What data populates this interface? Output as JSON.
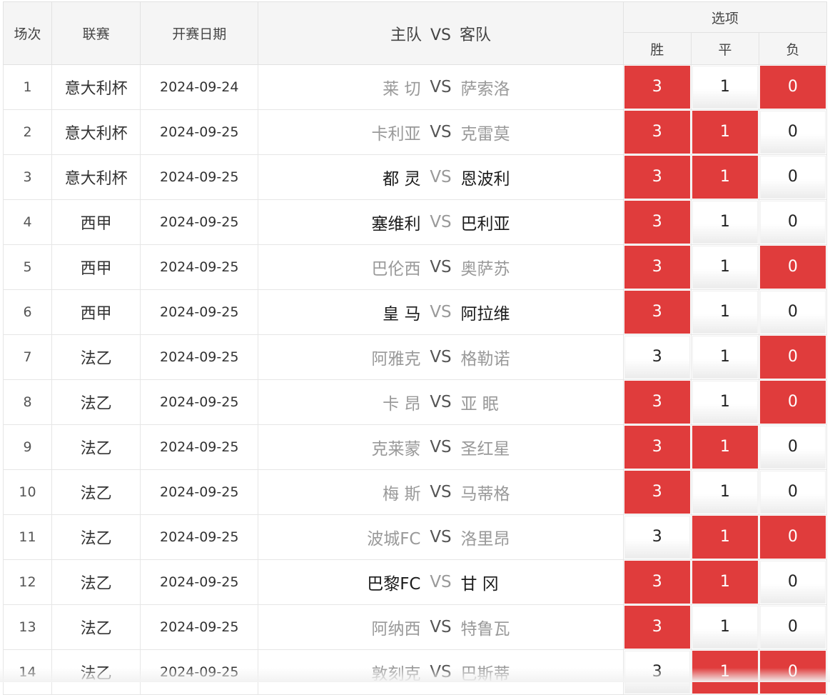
{
  "header": {
    "idx": "场次",
    "league": "联赛",
    "date": "开赛日期",
    "home": "主队",
    "vs": "VS",
    "away": "客队",
    "options": "选项",
    "win": "胜",
    "draw": "平",
    "lose": "负"
  },
  "rows": [
    {
      "idx": "1",
      "league": "意大利杯",
      "date": "2024-09-24",
      "home": "莱 切",
      "vs": "VS",
      "away": "萨索洛",
      "win": "3",
      "draw": "1",
      "lose": "0"
    },
    {
      "idx": "2",
      "league": "意大利杯",
      "date": "2024-09-25",
      "home": "卡利亚",
      "vs": "VS",
      "away": "克雷莫",
      "win": "3",
      "draw": "1",
      "lose": "0"
    },
    {
      "idx": "3",
      "league": "意大利杯",
      "date": "2024-09-25",
      "home": "都 灵",
      "vs": "VS",
      "away": "恩波利",
      "win": "3",
      "draw": "1",
      "lose": "0"
    },
    {
      "idx": "4",
      "league": "西甲",
      "date": "2024-09-25",
      "home": "塞维利",
      "vs": "VS",
      "away": "巴利亚",
      "win": "3",
      "draw": "1",
      "lose": "0"
    },
    {
      "idx": "5",
      "league": "西甲",
      "date": "2024-09-25",
      "home": "巴伦西",
      "vs": "VS",
      "away": "奥萨苏",
      "win": "3",
      "draw": "1",
      "lose": "0"
    },
    {
      "idx": "6",
      "league": "西甲",
      "date": "2024-09-25",
      "home": "皇 马",
      "vs": "VS",
      "away": "阿拉维",
      "win": "3",
      "draw": "1",
      "lose": "0"
    },
    {
      "idx": "7",
      "league": "法乙",
      "date": "2024-09-25",
      "home": "阿雅克",
      "vs": "VS",
      "away": "格勒诺",
      "win": "3",
      "draw": "1",
      "lose": "0"
    },
    {
      "idx": "8",
      "league": "法乙",
      "date": "2024-09-25",
      "home": "卡 昂",
      "vs": "VS",
      "away": "亚 眠",
      "win": "3",
      "draw": "1",
      "lose": "0"
    },
    {
      "idx": "9",
      "league": "法乙",
      "date": "2024-09-25",
      "home": "克莱蒙",
      "vs": "VS",
      "away": "圣红星",
      "win": "3",
      "draw": "1",
      "lose": "0"
    },
    {
      "idx": "10",
      "league": "法乙",
      "date": "2024-09-25",
      "home": "梅 斯",
      "vs": "VS",
      "away": "马蒂格",
      "win": "3",
      "draw": "1",
      "lose": "0"
    },
    {
      "idx": "11",
      "league": "法乙",
      "date": "2024-09-25",
      "home": "波城FC",
      "vs": "VS",
      "away": "洛里昂",
      "win": "3",
      "draw": "1",
      "lose": "0"
    },
    {
      "idx": "12",
      "league": "法乙",
      "date": "2024-09-25",
      "home": "巴黎FC",
      "vs": "VS",
      "away": "甘 冈",
      "win": "3",
      "draw": "1",
      "lose": "0"
    },
    {
      "idx": "13",
      "league": "法乙",
      "date": "2024-09-25",
      "home": "阿纳西",
      "vs": "VS",
      "away": "特鲁瓦",
      "win": "3",
      "draw": "1",
      "lose": "0"
    },
    {
      "idx": "14",
      "league": "法乙",
      "date": "2024-09-25",
      "home": "敦刻克",
      "vs": "VS",
      "away": "巴斯蒂",
      "win": "3",
      "draw": "1",
      "lose": "0"
    }
  ],
  "selection": {
    "r1": {
      "win": true,
      "draw": false,
      "lose": true
    },
    "r2": {
      "win": true,
      "draw": true,
      "lose": false
    },
    "r3": {
      "win": true,
      "draw": true,
      "lose": false
    },
    "r4": {
      "win": true,
      "draw": false,
      "lose": false
    },
    "r5": {
      "win": true,
      "draw": false,
      "lose": true
    },
    "r6": {
      "win": true,
      "draw": false,
      "lose": false
    },
    "r7": {
      "win": false,
      "draw": false,
      "lose": true
    },
    "r8": {
      "win": true,
      "draw": false,
      "lose": true
    },
    "r9": {
      "win": true,
      "draw": true,
      "lose": false
    },
    "r10": {
      "win": true,
      "draw": false,
      "lose": false
    },
    "r11": {
      "win": false,
      "draw": true,
      "lose": true
    },
    "r12": {
      "win": true,
      "draw": true,
      "lose": false
    },
    "r13": {
      "win": true,
      "draw": false,
      "lose": false
    },
    "r14": {
      "win": false,
      "draw": true,
      "lose": true
    }
  },
  "team_style": {
    "r1": "dim",
    "r2": "dim",
    "r3": "dark",
    "r4": "dark",
    "r5": "dim",
    "r6": "dark",
    "r7": "dim",
    "r8": "dim",
    "r9": "dim",
    "r10": "dim",
    "r11": "dim",
    "r12": "dark",
    "r13": "dim",
    "r14": "dim"
  },
  "colors": {
    "selected": "#e03c3c",
    "header_bg": "#f5f5f5",
    "team_dim": "#999999",
    "team_dark": "#1a1a1a"
  }
}
